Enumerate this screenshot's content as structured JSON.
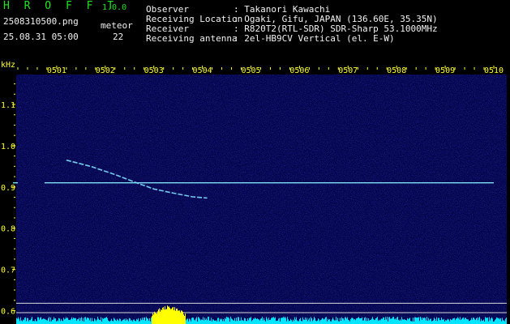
{
  "header": {
    "app_name": "H R O F F T",
    "version": "1.0.0",
    "filename": "2508310500.png",
    "datetime": "25.08.31 05:00",
    "meteor_label": "meteor",
    "meteor_count": "22",
    "info_labels": [
      "Observer",
      "Receiving Location",
      "Receiver",
      "Receiving antenna"
    ],
    "info_values": [
      ": Takanori Kawachi",
      ": Ogaki, Gifu, JAPAN (136.60E, 35.35N)",
      ": R820T2(RTL-SDR) SDR-Sharp 53.1000MHz",
      ": 2el-HB9CV Vertical (el. E-W)"
    ]
  },
  "colors": {
    "header_green": "#22e522",
    "header_white": "#f2f2f2",
    "tick_yellow": "#ffff33",
    "background_noise": "#0b0b7a",
    "signal_cyan": "#7fe0ff",
    "activity_cyan": "#00e5ff",
    "activity_yellow": "#ffff00"
  },
  "chart_data": {
    "type": "heatmap",
    "ylabel": "kHz",
    "x_ticks": [
      "0501",
      "0502",
      "0503",
      "0504",
      "0505",
      "0506",
      "0507",
      "0508",
      "0509",
      "0510"
    ],
    "x_range_min": [
      0,
      10
    ],
    "y_ticks": [
      "1.1",
      "1.0",
      "0.9",
      "0.8",
      "0.7",
      "0.6"
    ],
    "y_range_khz": [
      0.58,
      1.155
    ],
    "carrier": {
      "freq_khz": 0.91,
      "start_min": 0.1,
      "end_min": 10,
      "gap_min": [
        0.2,
        0.75
      ]
    },
    "meteor_echo": {
      "points_min_khz": [
        [
          1.2,
          0.965
        ],
        [
          1.7,
          0.95
        ],
        [
          2.2,
          0.93
        ],
        [
          2.6,
          0.912
        ],
        [
          3.0,
          0.895
        ],
        [
          3.4,
          0.885
        ],
        [
          3.8,
          0.876
        ],
        [
          4.1,
          0.873
        ]
      ]
    },
    "guide_lines_khz": [
      0.618,
      0.595
    ],
    "activity_highlight_min": [
      2.95,
      3.65
    ]
  }
}
